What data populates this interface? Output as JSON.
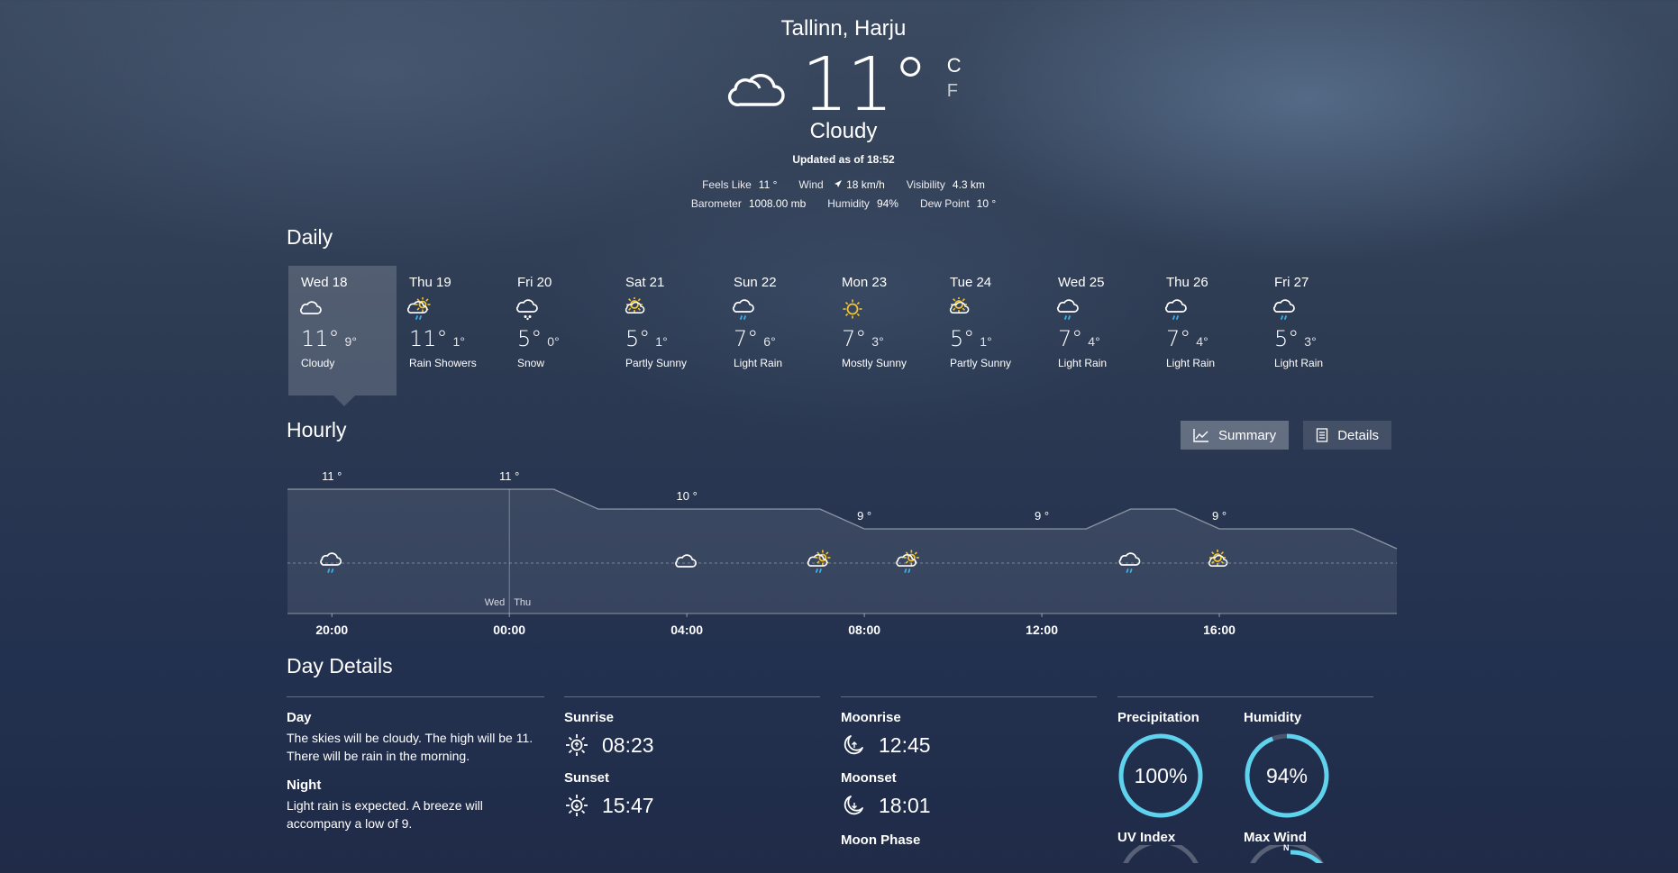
{
  "header": {
    "location": "Tallinn, Harju",
    "temp": "11°",
    "unit_c": "C",
    "unit_f": "F",
    "condition": "Cloudy",
    "icon": "cloud-icon",
    "updated": "Updated as of 18:52"
  },
  "stats_row1": [
    {
      "label": "Feels Like",
      "value": "11 °"
    },
    {
      "label": "Wind",
      "value": "18 km/h",
      "icon": "wind-arrow-icon"
    },
    {
      "label": "Visibility",
      "value": "4.3 km"
    }
  ],
  "stats_row2": [
    {
      "label": "Barometer",
      "value": "1008.00 mb"
    },
    {
      "label": "Humidity",
      "value": "94%"
    },
    {
      "label": "Dew Point",
      "value": "10 °"
    }
  ],
  "daily": {
    "title": "Daily",
    "days": [
      {
        "day": "Wed 18",
        "hi": "11°",
        "lo": "9°",
        "cond": "Cloudy",
        "icon": "cloudy",
        "selected": true
      },
      {
        "day": "Thu 19",
        "hi": "11°",
        "lo": "1°",
        "cond": "Rain Showers",
        "icon": "rain-sun"
      },
      {
        "day": "Fri 20",
        "hi": "5°",
        "lo": "0°",
        "cond": "Snow",
        "icon": "snow"
      },
      {
        "day": "Sat 21",
        "hi": "5°",
        "lo": "1°",
        "cond": "Partly Sunny",
        "icon": "partly-sunny"
      },
      {
        "day": "Sun 22",
        "hi": "7°",
        "lo": "6°",
        "cond": "Light Rain",
        "icon": "rain"
      },
      {
        "day": "Mon 23",
        "hi": "7°",
        "lo": "3°",
        "cond": "Mostly Sunny",
        "icon": "sun"
      },
      {
        "day": "Tue 24",
        "hi": "5°",
        "lo": "1°",
        "cond": "Partly Sunny",
        "icon": "partly-sunny"
      },
      {
        "day": "Wed 25",
        "hi": "7°",
        "lo": "4°",
        "cond": "Light Rain",
        "icon": "rain"
      },
      {
        "day": "Thu 26",
        "hi": "7°",
        "lo": "4°",
        "cond": "Light Rain",
        "icon": "rain"
      },
      {
        "day": "Fri 27",
        "hi": "5°",
        "lo": "3°",
        "cond": "Light Rain",
        "icon": "rain"
      }
    ]
  },
  "hourly": {
    "title": "Hourly",
    "summary_label": "Summary",
    "details_label": "Details",
    "temps": [
      11,
      11,
      11,
      11,
      11,
      11,
      11,
      10,
      10,
      10,
      10,
      10,
      10,
      9,
      9,
      9,
      9,
      9,
      9,
      10,
      10,
      9,
      9,
      9,
      9,
      8
    ],
    "temp_labels": [
      {
        "index": 1,
        "text": "11 °"
      },
      {
        "index": 5,
        "text": "11 °"
      },
      {
        "index": 9,
        "text": "10 °"
      },
      {
        "index": 13,
        "text": "9 °"
      },
      {
        "index": 17,
        "text": "9 °"
      },
      {
        "index": 21,
        "text": "9 °"
      }
    ],
    "icons": [
      {
        "index": 1,
        "icon": "rain"
      },
      {
        "index": 9,
        "icon": "cloudy"
      },
      {
        "index": 12,
        "icon": "rain-sun"
      },
      {
        "index": 14,
        "icon": "rain-sun"
      },
      {
        "index": 19,
        "icon": "rain"
      },
      {
        "index": 21,
        "icon": "partly-sunny"
      }
    ],
    "times": [
      {
        "index": 1,
        "text": "20:00"
      },
      {
        "index": 5,
        "text": "00:00"
      },
      {
        "index": 9,
        "text": "04:00"
      },
      {
        "index": 13,
        "text": "08:00"
      },
      {
        "index": 17,
        "text": "12:00"
      },
      {
        "index": 21,
        "text": "16:00"
      }
    ],
    "day_divider": {
      "index": 5,
      "left": "Wed",
      "right": "Thu"
    }
  },
  "day_details": {
    "title": "Day Details",
    "day_label": "Day",
    "day_text": "The skies will be cloudy. The high will be 11. There will be rain in the morning.",
    "night_label": "Night",
    "night_text": "Light rain is expected. A breeze will accompany a low of 9.",
    "sunrise_label": "Sunrise",
    "sunrise": "08:23",
    "sunset_label": "Sunset",
    "sunset": "15:47",
    "moonrise_label": "Moonrise",
    "moonrise": "12:45",
    "moonset_label": "Moonset",
    "moonset": "18:01",
    "moonphase_label": "Moon Phase",
    "precip_label": "Precipitation",
    "precip": "100%",
    "precip_fraction": 1.0,
    "humidity_label": "Humidity",
    "humidity": "94%",
    "humidity_fraction": 0.94,
    "uv_label": "UV Index",
    "wind_label": "Max Wind",
    "compass_n": "N"
  },
  "colors": {
    "ring": "#5fd3ee",
    "sun": "#f4c430",
    "rain": "#3fb0e8"
  }
}
